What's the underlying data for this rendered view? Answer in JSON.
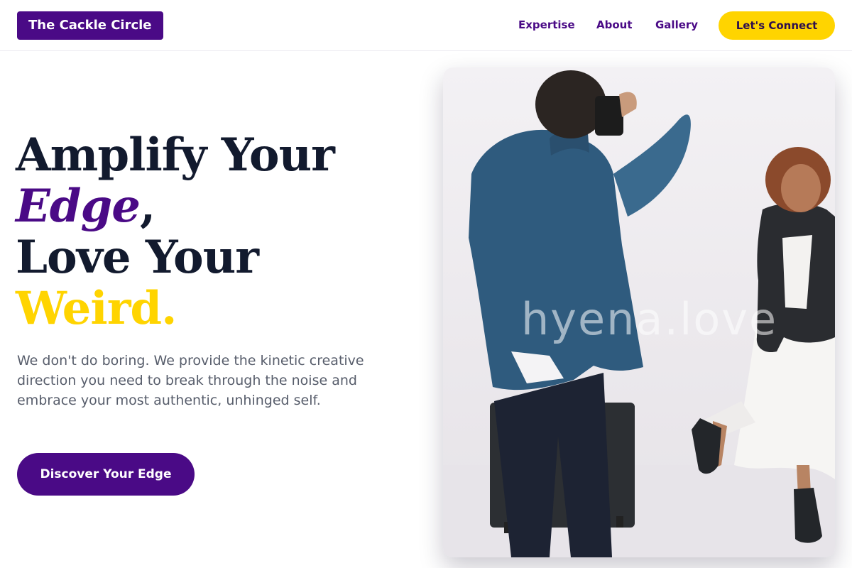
{
  "header": {
    "logo": "The Cackle Circle",
    "nav": [
      "Expertise",
      "About",
      "Gallery"
    ],
    "cta": "Let's Connect"
  },
  "hero": {
    "title_line1": "Amplify Your",
    "title_edge": "Edge",
    "title_comma": ",",
    "title_line3": "Love Your",
    "title_weird": "Weird.",
    "subtitle": "We don't do boring. We provide the kinetic creative direction you need to break through the noise and embrace your most authentic, unhinged self.",
    "button": "Discover Your Edge"
  },
  "media": {
    "watermark": "hyena.love"
  },
  "colors": {
    "brand_purple": "#4a0a86",
    "accent_yellow": "#ffd400",
    "heading_dark": "#121a2e",
    "body_gray": "#575d6b"
  }
}
